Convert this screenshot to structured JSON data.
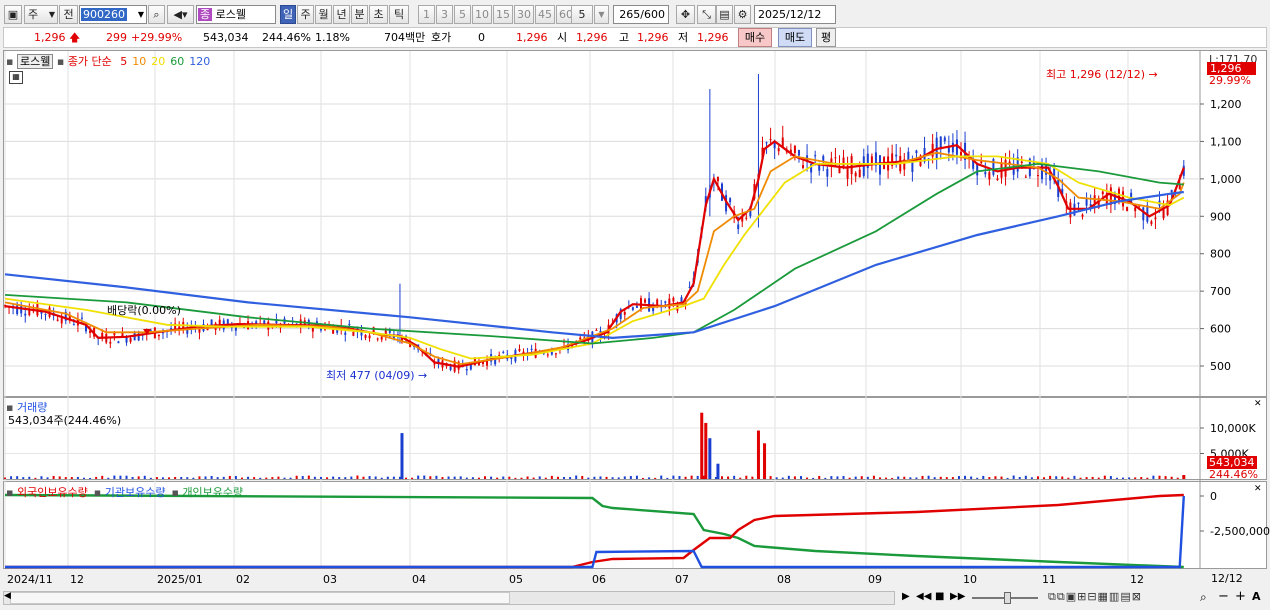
{
  "toolbar": {
    "type_select": "주",
    "prev_label": "전",
    "code": "900260",
    "name_badge": "종",
    "name": "로스웰",
    "period_buttons": [
      "일",
      "주",
      "월",
      "년",
      "분",
      "초",
      "틱"
    ],
    "interval_buttons": [
      "1",
      "3",
      "5",
      "10",
      "15",
      "30",
      "45",
      "60"
    ],
    "interval_custom": "5",
    "count": "265",
    "count_total": "/600",
    "date": "2025/12/12"
  },
  "quote": {
    "price": "1,296",
    "change": "299",
    "change_pct": "+29.99%",
    "volume": "543,034",
    "volume_pct": "244.46%",
    "turnover": "1.18%",
    "amount": "704백만",
    "hoga_label": "호가",
    "hoga_value": "0",
    "current": "1,296",
    "open_label": "시",
    "open": "1,296",
    "high_label": "고",
    "high": "1,296",
    "low_label": "저",
    "low": "1,296",
    "buy_button": "매수",
    "sell_button": "매도",
    "eval_button": "평"
  },
  "legend_main": {
    "name": "로스웰",
    "indicator": "종가 단순",
    "periods": [
      {
        "label": "5",
        "color": "#e00000"
      },
      {
        "label": "10",
        "color": "#f08a00"
      },
      {
        "label": "20",
        "color": "#f0e000"
      },
      {
        "label": "60",
        "color": "#1a9a3a"
      },
      {
        "label": "120",
        "color": "#3060e0"
      }
    ]
  },
  "legend_volume": {
    "title": "거래량",
    "value": "543,034주(244.46%)"
  },
  "legend_holdings": [
    {
      "label": "외국인보유수량",
      "color": "#e00000"
    },
    {
      "label": "기관보유수량",
      "color": "#2050e0"
    },
    {
      "label": "개인보유수량",
      "color": "#1a9a3a"
    }
  ],
  "annotations": {
    "high": "최고 1,296 (12/12)",
    "low": "최저 477 (04/09)",
    "dividend": "배당락(0.00%)"
  },
  "right_axis": {
    "top_label": "L:171.70",
    "price_tag": "1,296",
    "pct_tag": "29.99%",
    "volume_tag": "543,034",
    "volume_pct_tag": "244.46%",
    "end_date": "12/12"
  },
  "chart_data": {
    "type": "line",
    "price_axis": {
      "ylim": [
        400,
        1300
      ],
      "ticks": [
        500,
        600,
        700,
        800,
        900,
        "1,000",
        "1,100",
        "1,200"
      ]
    },
    "volume_axis": {
      "ticks": [
        "10,000K",
        "5,000K"
      ]
    },
    "holdings_axis": {
      "ticks": [
        "0",
        "-2,500,000"
      ]
    },
    "x_labels": [
      "2024/11",
      "12",
      "2025/01",
      "02",
      "03",
      "04",
      "05",
      "06",
      "07",
      "08",
      "09",
      "10",
      "11",
      "12"
    ],
    "series": [
      {
        "name": "5",
        "color": "#e00000",
        "points": [
          [
            0,
            660
          ],
          [
            20,
            645
          ],
          [
            40,
            610
          ],
          [
            46,
            575
          ],
          [
            60,
            578
          ],
          [
            75,
            590
          ],
          [
            95,
            605
          ],
          [
            115,
            612
          ],
          [
            135,
            610
          ],
          [
            155,
            608
          ],
          [
            170,
            600
          ],
          [
            185,
            585
          ],
          [
            195,
            580
          ],
          [
            203,
            555
          ],
          [
            212,
            510
          ],
          [
            224,
            498
          ],
          [
            240,
            518
          ],
          [
            260,
            535
          ],
          [
            272,
            545
          ],
          [
            285,
            565
          ],
          [
            297,
            590
          ],
          [
            304,
            645
          ],
          [
            310,
            665
          ],
          [
            325,
            660
          ],
          [
            335,
            670
          ],
          [
            340,
            720
          ],
          [
            346,
            930
          ],
          [
            350,
            1000
          ],
          [
            356,
            940
          ],
          [
            362,
            890
          ],
          [
            368,
            920
          ],
          [
            372,
            1000
          ],
          [
            375,
            1080
          ],
          [
            380,
            1100
          ],
          [
            390,
            1060
          ],
          [
            400,
            1040
          ],
          [
            415,
            1030
          ],
          [
            430,
            1040
          ],
          [
            450,
            1050
          ],
          [
            460,
            1080
          ],
          [
            470,
            1090
          ],
          [
            480,
            1040
          ],
          [
            490,
            1020
          ],
          [
            500,
            1030
          ],
          [
            515,
            1030
          ],
          [
            520,
            980
          ],
          [
            525,
            920
          ],
          [
            535,
            920
          ],
          [
            545,
            960
          ],
          [
            555,
            940
          ],
          [
            565,
            900
          ],
          [
            575,
            930
          ],
          [
            580,
            1000
          ],
          [
            582,
            1030
          ]
        ]
      },
      {
        "name": "10",
        "color": "#f08a00",
        "points": [
          [
            0,
            670
          ],
          [
            30,
            640
          ],
          [
            50,
            590
          ],
          [
            70,
            590
          ],
          [
            95,
            600
          ],
          [
            125,
            610
          ],
          [
            160,
            605
          ],
          [
            180,
            590
          ],
          [
            200,
            560
          ],
          [
            212,
            525
          ],
          [
            225,
            505
          ],
          [
            250,
            525
          ],
          [
            275,
            550
          ],
          [
            300,
            600
          ],
          [
            315,
            655
          ],
          [
            335,
            665
          ],
          [
            342,
            700
          ],
          [
            350,
            860
          ],
          [
            360,
            900
          ],
          [
            370,
            920
          ],
          [
            378,
            1020
          ],
          [
            390,
            1060
          ],
          [
            410,
            1040
          ],
          [
            440,
            1040
          ],
          [
            460,
            1070
          ],
          [
            480,
            1050
          ],
          [
            510,
            1030
          ],
          [
            520,
            1000
          ],
          [
            530,
            950
          ],
          [
            550,
            940
          ],
          [
            570,
            920
          ],
          [
            580,
            960
          ],
          [
            582,
            990
          ]
        ]
      },
      {
        "name": "20",
        "color": "#f0e000",
        "points": [
          [
            0,
            680
          ],
          [
            40,
            650
          ],
          [
            80,
            610
          ],
          [
            110,
            605
          ],
          [
            150,
            605
          ],
          [
            180,
            590
          ],
          [
            200,
            575
          ],
          [
            215,
            545
          ],
          [
            230,
            520
          ],
          [
            260,
            530
          ],
          [
            290,
            560
          ],
          [
            310,
            620
          ],
          [
            335,
            660
          ],
          [
            345,
            680
          ],
          [
            355,
            770
          ],
          [
            365,
            850
          ],
          [
            375,
            920
          ],
          [
            385,
            990
          ],
          [
            400,
            1040
          ],
          [
            440,
            1040
          ],
          [
            470,
            1060
          ],
          [
            490,
            1060
          ],
          [
            515,
            1040
          ],
          [
            530,
            990
          ],
          [
            555,
            950
          ],
          [
            575,
            930
          ],
          [
            582,
            950
          ]
        ]
      },
      {
        "name": "60",
        "color": "#1a9a3a",
        "points": [
          [
            0,
            690
          ],
          [
            60,
            670
          ],
          [
            120,
            630
          ],
          [
            180,
            600
          ],
          [
            240,
            580
          ],
          [
            290,
            560
          ],
          [
            320,
            575
          ],
          [
            340,
            590
          ],
          [
            360,
            650
          ],
          [
            390,
            760
          ],
          [
            430,
            860
          ],
          [
            460,
            960
          ],
          [
            480,
            1020
          ],
          [
            510,
            1040
          ],
          [
            540,
            1020
          ],
          [
            570,
            990
          ],
          [
            582,
            985
          ]
        ]
      },
      {
        "name": "120",
        "color": "#3060e0",
        "points": [
          [
            0,
            745
          ],
          [
            60,
            710
          ],
          [
            120,
            670
          ],
          [
            200,
            630
          ],
          [
            270,
            590
          ],
          [
            300,
            575
          ],
          [
            340,
            590
          ],
          [
            380,
            660
          ],
          [
            430,
            770
          ],
          [
            480,
            850
          ],
          [
            520,
            900
          ],
          [
            550,
            940
          ],
          [
            575,
            960
          ],
          [
            582,
            965
          ]
        ]
      }
    ],
    "holdings": [
      {
        "name": "외국인보유수량",
        "color": "#e00000"
      },
      {
        "name": "기관보유수량",
        "color": "#2050e0"
      },
      {
        "name": "개인보유수량",
        "color": "#1a9a3a"
      }
    ],
    "volume_spikes": [
      [
        196,
        9000
      ],
      [
        344,
        13000
      ],
      [
        346,
        11000
      ],
      [
        348,
        8000
      ],
      [
        352,
        3000
      ],
      [
        372,
        9500
      ],
      [
        375,
        7000
      ]
    ]
  }
}
